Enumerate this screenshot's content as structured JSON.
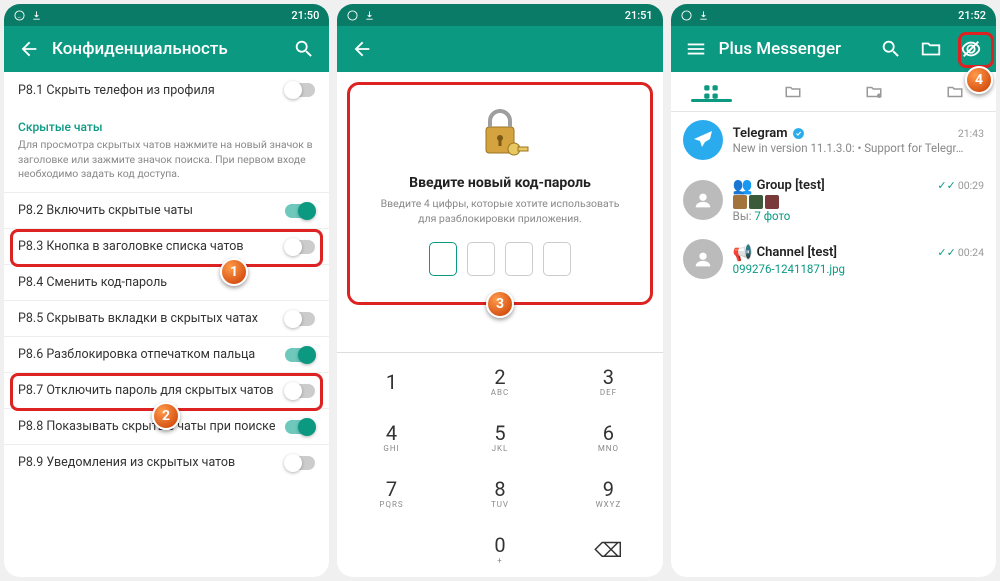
{
  "phone1": {
    "time": "21:50",
    "title": "Конфиденциальность",
    "items": [
      {
        "label": "P8.1 Скрыть телефон из профиля",
        "on": false
      },
      {
        "label": "P8.2 Включить скрытые чаты",
        "on": true
      },
      {
        "label": "P8.3 Кнопка в заголовке списка чатов",
        "on": false
      },
      {
        "label": "P8.4 Сменить код-пароль",
        "on": null
      },
      {
        "label": "P8.5 Скрывать вкладки в скрытых чатах",
        "on": false
      },
      {
        "label": "P8.6 Разблокировка отпечатком пальца",
        "on": true
      },
      {
        "label": "P8.7 Отключить пароль для скрытых чатов",
        "on": false
      },
      {
        "label": "P8.8 Показывать скрытые чаты при поиске",
        "on": true
      },
      {
        "label": "P8.9 Уведомления из скрытых чатов",
        "on": false
      }
    ],
    "section_title": "Скрытые чаты",
    "section_desc": "Для просмотра скрытых чатов нажмите на новый значок в заголовке или зажмите значок поиска. При первом входе необходимо задать код доступа."
  },
  "phone2": {
    "time": "21:51",
    "title": "Введите новый код-пароль",
    "desc": "Введите 4 цифры, которые хотите использовать для разблокировки приложения.",
    "keys": [
      {
        "n": "1",
        "l": ""
      },
      {
        "n": "2",
        "l": "ABC"
      },
      {
        "n": "3",
        "l": "DEF"
      },
      {
        "n": "4",
        "l": "GHI"
      },
      {
        "n": "5",
        "l": "JKL"
      },
      {
        "n": "6",
        "l": "MNO"
      },
      {
        "n": "7",
        "l": "PQRS"
      },
      {
        "n": "8",
        "l": "TUV"
      },
      {
        "n": "9",
        "l": "WXYZ"
      },
      {
        "n": "",
        "l": ""
      },
      {
        "n": "0",
        "l": "+"
      },
      {
        "n": "⌫",
        "l": ""
      }
    ]
  },
  "phone3": {
    "time": "21:52",
    "title": "Plus Messenger",
    "chats": [
      {
        "name": "Telegram",
        "verified": true,
        "time": "21:43",
        "msg_prefix": "New in version 11.1.3.0:  • Support for Telegr…",
        "msg_suffix": "",
        "checks": false
      },
      {
        "name": "Group [test]",
        "icon": "group",
        "time": "00:29",
        "msg_prefix": "Вы: ",
        "msg_suffix": "7 фото",
        "checks": true,
        "thumbs": true
      },
      {
        "name": "Channel [test]",
        "icon": "channel",
        "time": "00:24",
        "msg_prefix": "",
        "msg_suffix": "099276-12411871.jpg",
        "checks": true
      }
    ]
  },
  "badges": {
    "b1": "1",
    "b2": "2",
    "b3": "3",
    "b4": "4"
  }
}
